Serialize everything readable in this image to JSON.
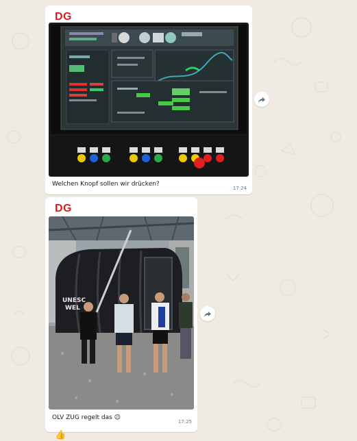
{
  "messages": [
    {
      "sender": "DG",
      "caption": "Welchen Knopf sollen wir drücken?",
      "time": "17:24",
      "media": "control-panel-photo"
    },
    {
      "sender": "DG",
      "caption": "OLV ZUG regelt das 😉",
      "time": "17:25",
      "media": "cable-car-cabin-photo",
      "reaction": "👍"
    }
  ],
  "icons": {
    "forward": "forward-arrow-icon"
  },
  "colors": {
    "chat_background": "#efeae2",
    "bubble": "#ffffff",
    "sender_name": "#e21b1b",
    "timestamp": "#667781"
  }
}
